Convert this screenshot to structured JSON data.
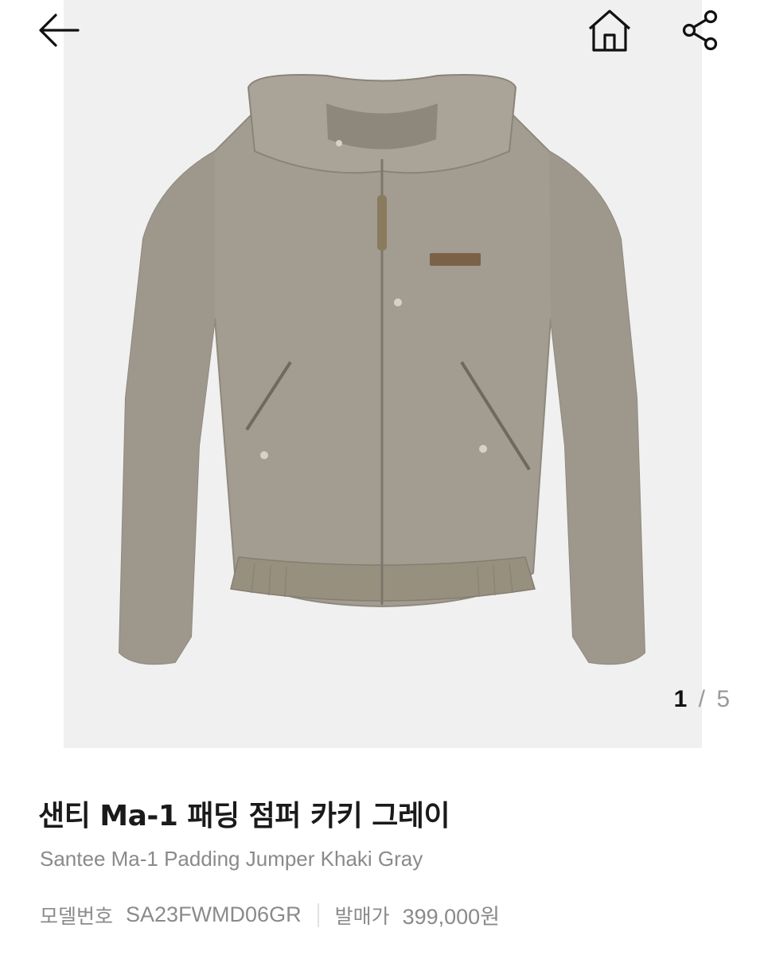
{
  "header": {
    "back_icon": "arrow-left-icon",
    "home_icon": "home-icon",
    "share_icon": "share-icon"
  },
  "gallery": {
    "image_subject": "jacket",
    "current_page": "1",
    "separator": "/",
    "total_pages": "5",
    "product_color": "#a39c90"
  },
  "product": {
    "title": "샌티 Ma-1 패딩 점퍼 카키 그레이",
    "subtitle": "Santee Ma-1 Padding Jumper Khaki Gray",
    "model_label": "모델번호",
    "model_value": "SA23FWMD06GR",
    "price_label": "발매가",
    "price_value": "399,000원"
  }
}
